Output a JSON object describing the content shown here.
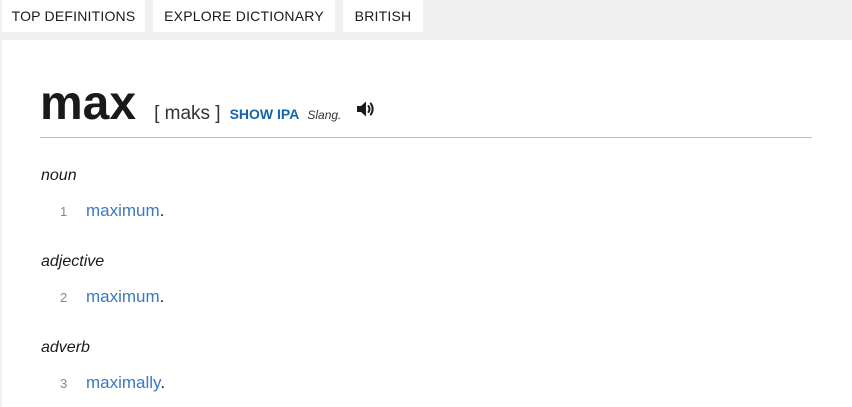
{
  "tabs": [
    {
      "label": "TOP DEFINITIONS"
    },
    {
      "label": "EXPLORE DICTIONARY"
    },
    {
      "label": "BRITISH"
    }
  ],
  "entry": {
    "headword": "max",
    "pronunciation": "[ maks ]",
    "show_ipa": "SHOW IPA",
    "label": "Slang."
  },
  "senses": [
    {
      "pos": "noun",
      "number": "1",
      "link": "maximum",
      "end": "."
    },
    {
      "pos": "adjective",
      "number": "2",
      "link": "maximum",
      "end": "."
    },
    {
      "pos": "adverb",
      "number": "3",
      "link": "maximally",
      "end": "."
    }
  ],
  "icons": {
    "audio": "speaker-icon"
  }
}
